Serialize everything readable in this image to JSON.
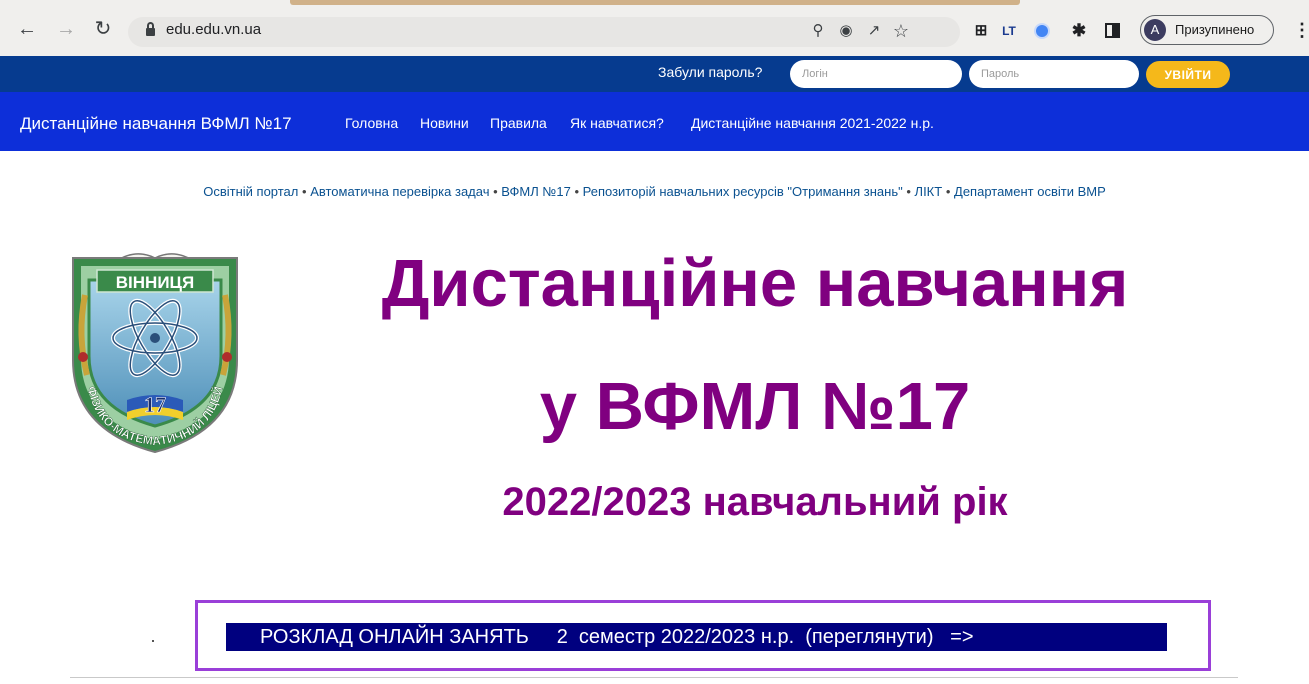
{
  "browser": {
    "url": "edu.edu.vn.ua",
    "profile_initial": "A",
    "profile_label": "Призупинено",
    "icons": [
      "back-icon",
      "forward-icon",
      "reload-icon",
      "lock-icon",
      "zoom-icon",
      "eye-off-icon",
      "share-icon",
      "star-icon",
      "screenshot-icon",
      "translate-icon",
      "extension-dot-icon",
      "puzzle-icon",
      "side-panel-icon",
      "menu-dots-icon"
    ]
  },
  "login": {
    "forgot": "Забули пароль?",
    "login_placeholder": "Логін",
    "password_placeholder": "Пароль",
    "submit": "УВІЙТИ"
  },
  "nav": {
    "brand": "Дистанційне навчання ВФМЛ №17",
    "items": [
      "Головна",
      "Новини",
      "Правила",
      "Як навчатися?",
      "Дистанційне навчання 2021-2022 н.р."
    ]
  },
  "links": {
    "items": [
      "Освітній портал",
      "Автоматична перевірка задач",
      "ВФМЛ №17",
      "Репозиторій навчальних ресурсів \"Отримання знань\"",
      "ЛІКТ",
      "Департамент освіти ВМР"
    ],
    "separator": "•"
  },
  "emblem": {
    "city": "ВІННИЦЯ",
    "number": "17",
    "ring_text": "ФІЗИКО-МАТЕМАТИЧНИЙ ЛІЦЕЙ"
  },
  "hero": {
    "line1": "Дистанційне навчання",
    "line2": "у  ВФМЛ №17",
    "line3": "2022/2023 навчальний рік"
  },
  "schedule": {
    "label": "РОЗКЛАД ОНЛАЙН ЗАНЯТЬ     2  семестр 2022/2023 н.р.  (переглянути)   =>"
  },
  "colors": {
    "login_bar": "#063b8f",
    "nav_bar": "#0d2fd9",
    "title": "#800080",
    "login_button": "#f5b81a",
    "schedule_button": "#00007f",
    "schedule_frame": "#9a3fd8"
  }
}
